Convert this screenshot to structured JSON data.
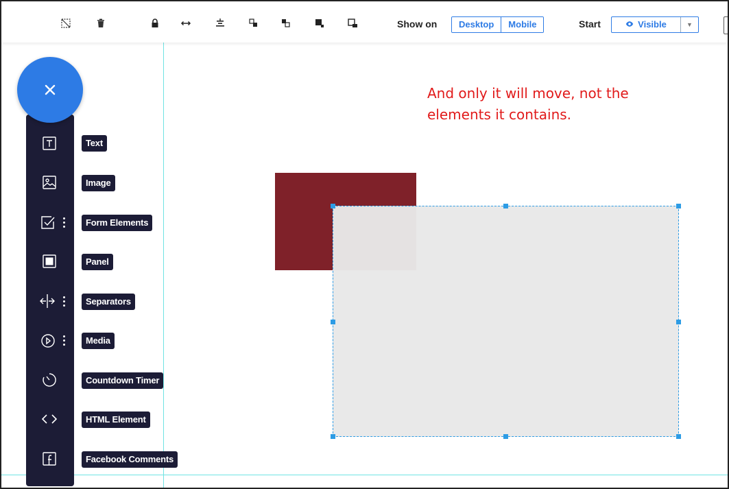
{
  "toolbar": {
    "icons": [
      "lock-off-icon",
      "trash-icon",
      "lock-icon",
      "stretch-horizontal-icon",
      "align-center-icon",
      "send-backward-icon",
      "bring-forward-icon",
      "send-to-back-icon",
      "bring-to-front-icon"
    ],
    "show_on_label": "Show on",
    "desktop_label": "Desktop",
    "mobile_label": "Mobile",
    "start_label": "Start",
    "visible_label": "Visible"
  },
  "annotation": {
    "line1": "And only it will move, not the",
    "line2": "elements it contains."
  },
  "add_menu": {
    "items": [
      {
        "label": "Text",
        "icon": "text-icon"
      },
      {
        "label": "Image",
        "icon": "image-icon"
      },
      {
        "label": "Form Elements",
        "icon": "checkbox-icon"
      },
      {
        "label": "Panel",
        "icon": "panel-icon"
      },
      {
        "label": "Separators",
        "icon": "separator-icon"
      },
      {
        "label": "Media",
        "icon": "play-icon"
      },
      {
        "label": "Countdown Timer",
        "icon": "timer-icon"
      },
      {
        "label": "HTML Element",
        "icon": "code-icon"
      },
      {
        "label": "Facebook Comments",
        "icon": "facebook-icon"
      }
    ]
  },
  "colors": {
    "accent": "#2d7be5",
    "rail": "#1c1c36",
    "guide": "#6fe3e3",
    "annotation": "#e11a1a",
    "red_box": "#7f2129",
    "selection": "#2d9ce5"
  }
}
